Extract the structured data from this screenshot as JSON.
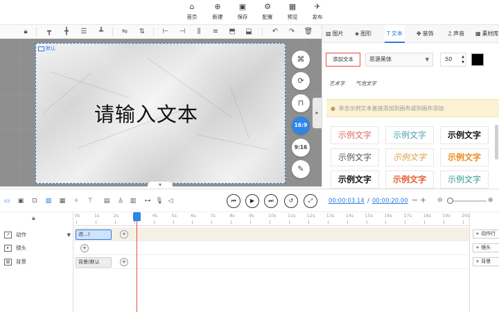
{
  "topbar": {
    "items": [
      {
        "label": "首页",
        "icon": "home-icon",
        "glyph": "⌂"
      },
      {
        "label": "新建",
        "icon": "new-file-icon",
        "glyph": "⊕"
      },
      {
        "label": "保存",
        "icon": "save-icon",
        "glyph": "▣"
      },
      {
        "label": "配置",
        "icon": "settings-icon",
        "glyph": "⚙"
      },
      {
        "label": "预览",
        "icon": "preview-icon",
        "glyph": "▦"
      },
      {
        "label": "发布",
        "icon": "publish-icon",
        "glyph": "✈"
      }
    ]
  },
  "canvas": {
    "tag": "默认",
    "text": "请输入文本",
    "aspect_buttons": [
      "16:9",
      "9:16"
    ]
  },
  "right_panel": {
    "tabs": [
      {
        "label": "图片",
        "glyph": "▨"
      },
      {
        "label": "图形",
        "glyph": "◈"
      },
      {
        "label": "文本",
        "glyph": "T"
      },
      {
        "label": "装饰",
        "glyph": "✤"
      },
      {
        "label": "声音",
        "glyph": "♫"
      },
      {
        "label": "素材库",
        "glyph": "▦"
      }
    ],
    "active_tab": "文本",
    "add_text_label": "添加文本",
    "font": "思源黑体",
    "font_size": "50",
    "color": "#000000",
    "subtabs": [
      "艺术字",
      "气泡文字"
    ],
    "hint": "单击示例文本直接添加到画布或到画布添加",
    "samples": [
      "示例文字",
      "示例文字",
      "示例文字",
      "示例文字",
      "示例文字",
      "示例文字",
      "示例文字",
      "示例文字",
      "示例文字"
    ]
  },
  "timeline": {
    "current_time": "00:00:03.14",
    "separator": "/",
    "total_time": "00:00:20.00",
    "minus": "−",
    "plus": "+",
    "ruler": [
      "0s",
      "1s",
      "2s",
      "3s",
      "4s",
      "5s",
      "6s",
      "7s",
      "8s",
      "9s",
      "10s",
      "11s",
      "12s",
      "13s",
      "14s",
      "15s",
      "16s",
      "17s",
      "18s",
      "19s",
      "20s"
    ],
    "tracks": [
      {
        "label": "动作",
        "clip": "进...)",
        "add_label": "+ 动作行"
      },
      {
        "label": "镜头",
        "clip": "",
        "add_label": "+ 镜头"
      },
      {
        "label": "背景",
        "clip": "背景(默认",
        "add_label": "+ 背景"
      }
    ],
    "progress_fraction": 0.157
  }
}
